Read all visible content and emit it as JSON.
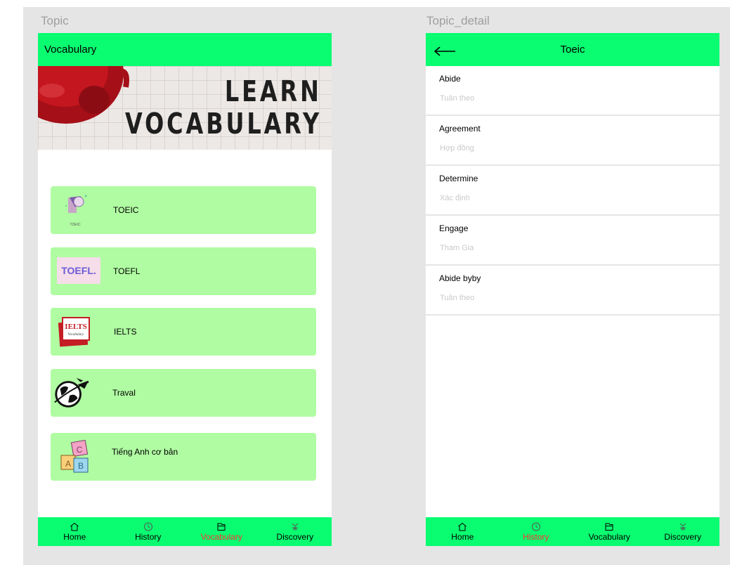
{
  "screens": {
    "topic": {
      "frame_label": "Topic",
      "appbar_title": "Vocabulary",
      "banner": {
        "line1": "LEARN",
        "line2": "VOCABULARY"
      },
      "topics": [
        {
          "label": "TOEIC",
          "thumb_text": "TOEIC"
        },
        {
          "label": "TOEFL",
          "thumb_text": "TOEFL."
        },
        {
          "label": "IELTS",
          "thumb_text": "IELTS",
          "thumb_sub": "Vocabulary"
        },
        {
          "label": "Traval"
        },
        {
          "label": "Tiếng Anh cơ bản",
          "thumb_letters": [
            "C",
            "A",
            "B"
          ]
        }
      ],
      "nav": {
        "active": "Vocabulary",
        "items": [
          {
            "label": "Home",
            "icon": "home-icon"
          },
          {
            "label": "History",
            "icon": "clock-icon"
          },
          {
            "label": "Vocabulary",
            "icon": "book-icon"
          },
          {
            "label": "Discovery",
            "icon": "discovery-icon"
          }
        ]
      }
    },
    "topic_detail": {
      "frame_label": "Topic_detail",
      "title": "Toeic",
      "words": [
        {
          "en": "Abide",
          "vi": "Tuân theo"
        },
        {
          "en": "Agreement",
          "vi": "Hợp đồng"
        },
        {
          "en": "Determine",
          "vi": "Xác định"
        },
        {
          "en": "Engage",
          "vi": "Tham Gia"
        },
        {
          "en": "Abide byby",
          "vi": "Tuân theo"
        }
      ],
      "nav": {
        "active": "History",
        "items": [
          {
            "label": "Home",
            "icon": "home-icon"
          },
          {
            "label": "History",
            "icon": "clock-icon"
          },
          {
            "label": "Vocabulary",
            "icon": "book-icon"
          },
          {
            "label": "Discovery",
            "icon": "discovery-icon"
          }
        ]
      }
    }
  },
  "colors": {
    "appbar": "#0afc70",
    "card": "#b0fca2",
    "active_nav": "#ff3333",
    "canvas": "#e5e5e5",
    "subtitle": "#c9c9c9"
  }
}
